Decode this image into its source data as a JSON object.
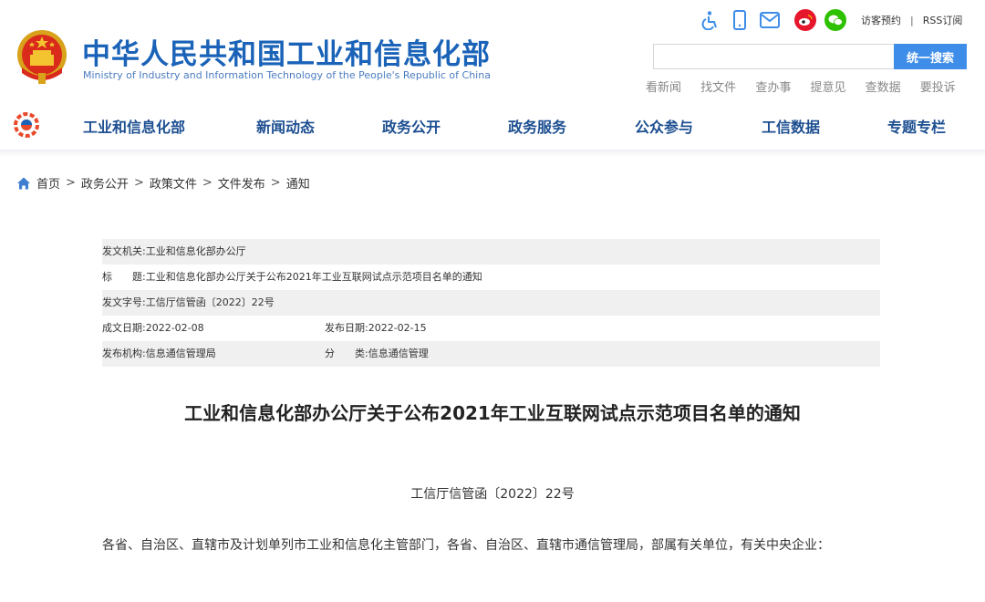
{
  "header": {
    "title": "中华人民共和国工业和信息化部",
    "subtitle": "Ministry of Industry and Information Technology of the People's Republic of China",
    "top_icons": [
      "accessibility-icon",
      "mobile-icon",
      "mail-icon",
      "weibo-icon",
      "wechat-icon"
    ],
    "visitor_booking": "访客预约",
    "separator": "|",
    "rss": "RSS订阅",
    "search_placeholder": "",
    "search_button": "统一搜索",
    "quick_links": [
      "看新闻",
      "找文件",
      "查办事",
      "提意见",
      "查数据",
      "要投诉"
    ],
    "colors": {
      "brand": "#1a63b8",
      "nav_text": "#1d4f91",
      "search_button": "#3e8de8",
      "weibo": "#e6162d",
      "wechat": "#2dc100"
    }
  },
  "nav": {
    "items": [
      "工业和信息化部",
      "新闻动态",
      "政务公开",
      "政务服务",
      "公众参与",
      "工信数据",
      "专题专栏"
    ]
  },
  "breadcrumb": {
    "items": [
      "首页",
      "政务公开",
      "政策文件",
      "文件发布",
      "通知"
    ],
    "separator": ">"
  },
  "meta": {
    "issuer_label": "发文机关:",
    "issuer": "工业和信息化部办公厅",
    "title_label": "标　　题:",
    "title": "工业和信息化部办公厅关于公布2021年工业互联网试点示范项目名单的通知",
    "doc_no_label": "发文字号:",
    "doc_no": "工信厅信管函〔2022〕22号",
    "created_label": "成文日期:",
    "created": "2022-02-08",
    "published_label": "发布日期:",
    "published": "2022-02-15",
    "agency_label": "发布机构:",
    "agency": "信息通信管理局",
    "category_label": "分　　类:",
    "category": "信息通信管理"
  },
  "document": {
    "title": "工业和信息化部办公厅关于公布2021年工业互联网试点示范项目名单的通知",
    "number": "工信厅信管函〔2022〕22号",
    "salutation": "各省、自治区、直辖市及计划单列市工业和信息化主管部门，各省、自治区、直辖市通信管理局，部属有关单位，有关中央企业："
  }
}
